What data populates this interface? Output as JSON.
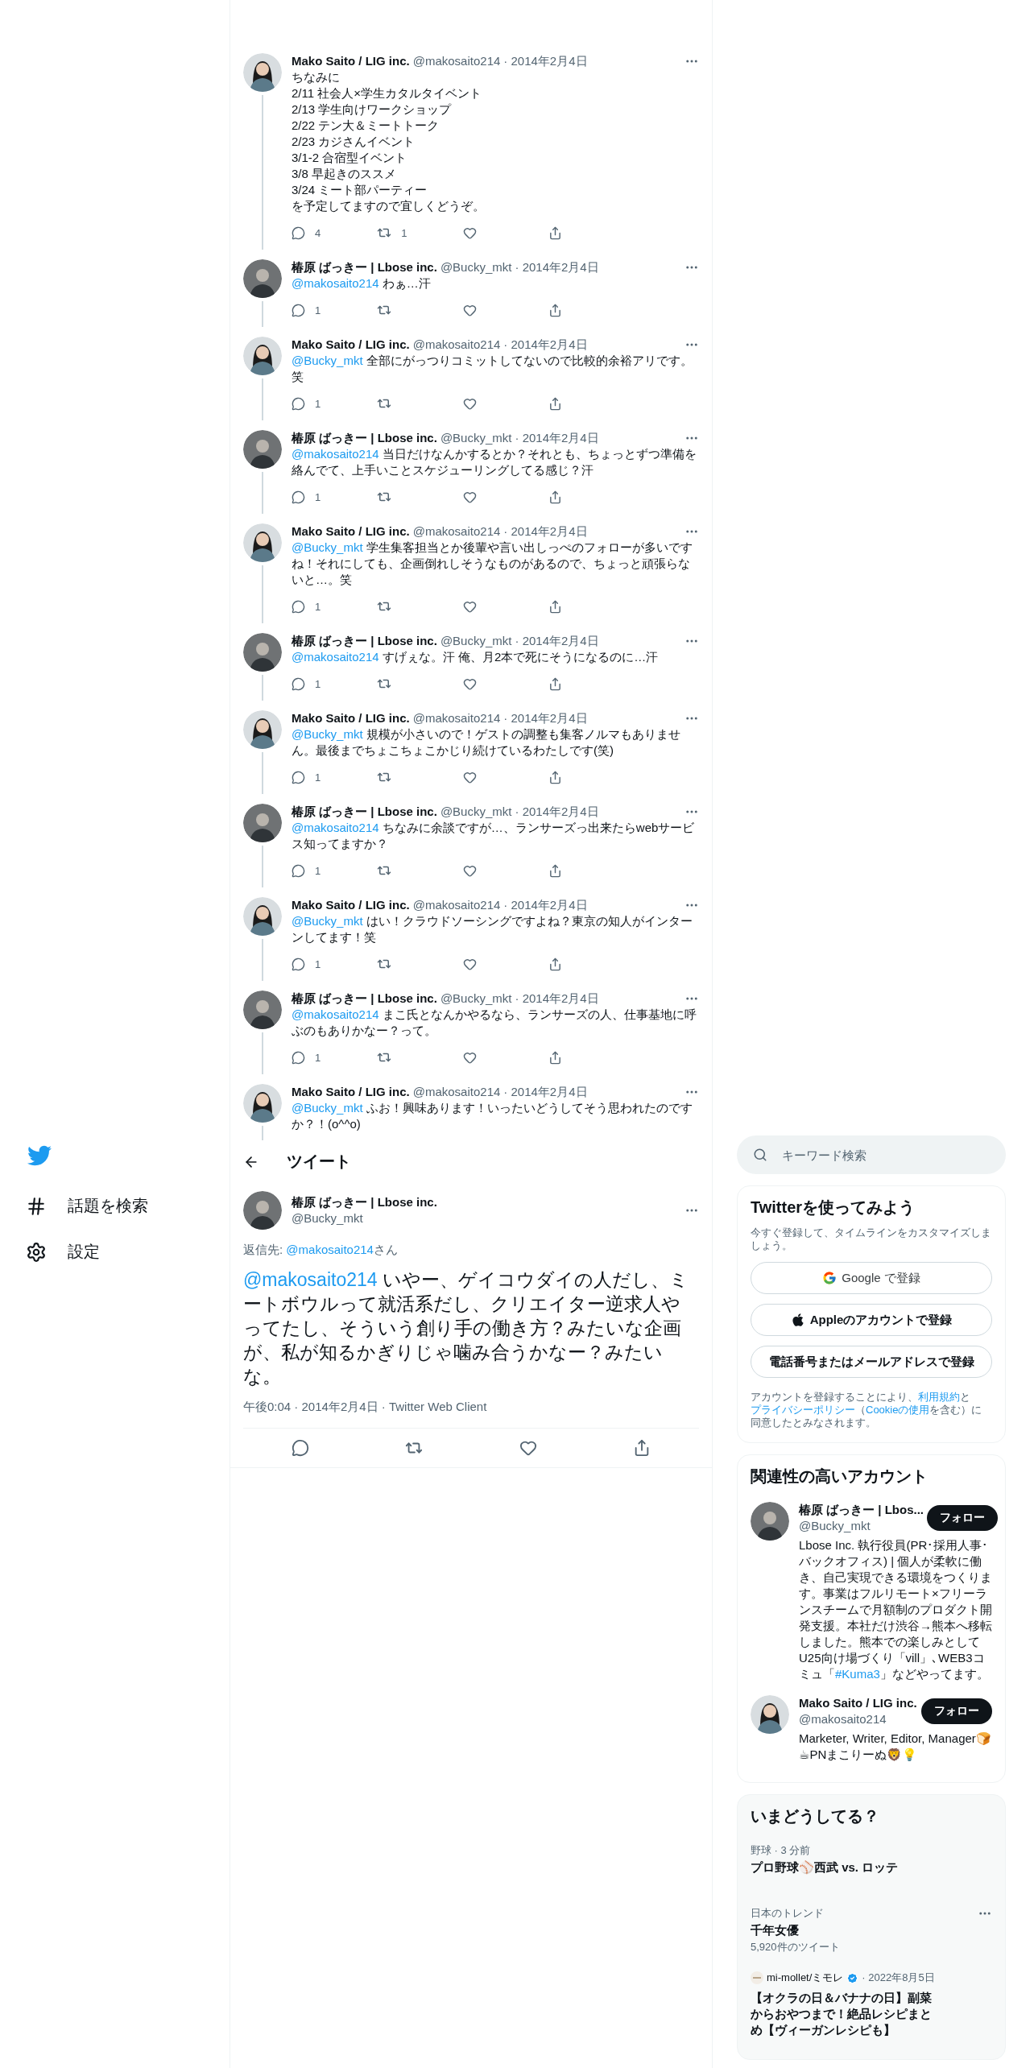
{
  "thread": [
    {
      "name": "Mako Saito / LIG inc.",
      "handle": "@makosaito214",
      "date": "· 2014年2月4日",
      "kind": "woman",
      "lines": [
        "ちなみに",
        "2/11 社会人×学生カタルタイベント",
        "2/13 学生向けワークショップ",
        "2/22 テン大＆ミートトーク",
        "2/23 カジさんイベント",
        "3/1-2 合宿型イベント",
        "3/8 早起きのススメ",
        "3/24 ミート部パーティー",
        "を予定してますので宜しくどうぞ。"
      ],
      "replies": "4",
      "retweets": "1"
    },
    {
      "name": "椿原 ばっきー | Lbose inc.",
      "handle": "@Bucky_mkt",
      "date": "· 2014年2月4日",
      "kind": "man",
      "mention": "@makosaito214",
      "text": " わぁ…汗",
      "replies": "1"
    },
    {
      "name": "Mako Saito / LIG inc.",
      "handle": "@makosaito214",
      "date": "· 2014年2月4日",
      "kind": "woman",
      "mention": "@Bucky_mkt",
      "text": " 全部にがっつりコミットしてないので比較的余裕アリです。笑",
      "replies": "1"
    },
    {
      "name": "椿原 ばっきー | Lbose inc.",
      "handle": "@Bucky_mkt",
      "date": "· 2014年2月4日",
      "kind": "man",
      "mention": "@makosaito214",
      "text": " 当日だけなんかするとか？それとも、ちょっとずつ準備を絡んでて、上手いことスケジューリングしてる感じ？汗",
      "replies": "1"
    },
    {
      "name": "Mako Saito / LIG inc.",
      "handle": "@makosaito214",
      "date": "· 2014年2月4日",
      "kind": "woman",
      "mention": "@Bucky_mkt",
      "text": " 学生集客担当とか後輩や言い出しっぺのフォローが多いですね！それにしても、企画倒れしそうなものがあるので、ちょっと頑張らないと…。笑",
      "replies": "1"
    },
    {
      "name": "椿原 ばっきー | Lbose inc.",
      "handle": "@Bucky_mkt",
      "date": "· 2014年2月4日",
      "kind": "man",
      "mention": "@makosaito214",
      "text": " すげぇな。汗 俺、月2本で死にそうになるのに…汗",
      "replies": "1"
    },
    {
      "name": "Mako Saito / LIG inc.",
      "handle": "@makosaito214",
      "date": "· 2014年2月4日",
      "kind": "woman",
      "mention": "@Bucky_mkt",
      "text": " 規模が小さいので！ゲストの調整も集客ノルマもありません。最後までちょこちょこかじり続けているわたしです(笑)",
      "replies": "1"
    },
    {
      "name": "椿原 ばっきー | Lbose inc.",
      "handle": "@Bucky_mkt",
      "date": "· 2014年2月4日",
      "kind": "man",
      "mention": "@makosaito214",
      "text": " ちなみに余談ですが…、ランサーズっ出来たらwebサービス知ってますか？",
      "replies": "1"
    },
    {
      "name": "Mako Saito / LIG inc.",
      "handle": "@makosaito214",
      "date": "· 2014年2月4日",
      "kind": "woman",
      "mention": "@Bucky_mkt",
      "text": " はい！クラウドソーシングですよね？東京の知人がインターンしてます！笑",
      "replies": "1"
    },
    {
      "name": "椿原 ばっきー | Lbose inc.",
      "handle": "@Bucky_mkt",
      "date": "· 2014年2月4日",
      "kind": "man",
      "mention": "@makosaito214",
      "text": " まこ氏となんかやるなら、ランサーズの人、仕事基地に呼ぶのもありかなー？って。",
      "replies": "1"
    },
    {
      "name": "Mako Saito / LIG inc.",
      "handle": "@makosaito214",
      "date": "· 2014年2月4日",
      "kind": "woman",
      "mention": "@Bucky_mkt",
      "text": " ふお！興味あります！いったいどうしてそう思われたのですか？！(o^^o)"
    }
  ],
  "header": {
    "title": "ツイート"
  },
  "main_tweet": {
    "name": "椿原 ばっきー | Lbose inc.",
    "handle": "@Bucky_mkt",
    "kind": "man",
    "reply_label": "返信先: ",
    "reply_to": "@makosaito214",
    "reply_suffix": "さん",
    "mention": "@makosaito214",
    "text": " いやー、ゲイコウダイの人だし、ミートボウルって就活系だし、クリエイター逆求人やってたし、そういう創り手の働き方？みたいな企画が、私が知るかぎりじゃ噛み合うかなー？みたいな。",
    "meta": "午後0:04 · 2014年2月4日 · Twitter Web Client"
  },
  "nav": {
    "items": [
      {
        "label": "話題を検索"
      },
      {
        "label": "設定"
      }
    ]
  },
  "search": {
    "placeholder": "キーワード検索"
  },
  "signup": {
    "title": "Twitterを使ってみよう",
    "subtitle": "今すぐ登録して、タイムラインをカスタマイズしましょう。",
    "buttons": [
      {
        "kind": "google",
        "label": "Google で登録"
      },
      {
        "kind": "apple",
        "label": "Appleのアカウントで登録"
      },
      {
        "kind": "plain",
        "label": "電話番号またはメールアドレスで登録"
      }
    ],
    "legal": [
      {
        "text": "アカウントを登録することにより、"
      },
      {
        "text": "利用規約",
        "link": true
      },
      {
        "text": "と"
      },
      {
        "text": "プライバシーポリシー",
        "link": true
      },
      {
        "text": "（"
      },
      {
        "text": "Cookieの使用",
        "link": true
      },
      {
        "text": "を含む）に同意したとみなされます。"
      }
    ]
  },
  "related": {
    "title": "関連性の高いアカウント",
    "accounts": [
      {
        "name": "椿原 ばっきー | Lbos...",
        "handle": "@Bucky_mkt",
        "kind": "man",
        "button": "フォロー",
        "bio": [
          {
            "text": "Lbose Inc. 執行役員(PR･採用人事･バックオフィス) | 個人が柔軟に働き、自己実現できる環境をつくります。事業はフルリモート×フリーランスチームで月額制のプロダクト開発支援。本社だけ渋谷→熊本へ移転しました。熊本での楽しみとしてU25向け場づくり「vill」､WEB3コミュ「"
          },
          {
            "text": "#Kuma3",
            "link": true
          },
          {
            "text": "」などやってます。"
          }
        ]
      },
      {
        "name": "Mako Saito / LIG inc.",
        "handle": "@makosaito214",
        "kind": "woman",
        "button": "フォロー",
        "bio": [
          {
            "text": "Marketer, Writer, Editor, Manager🍞☕PNまこりーぬ🦁💡"
          }
        ]
      }
    ]
  },
  "trends": {
    "title": "いまどうしてる？",
    "items": [
      {
        "kind": "event",
        "meta": "野球 · 3 分前",
        "title": "プロ野球⚾西武 vs. ロッテ"
      },
      {
        "kind": "trend",
        "meta": "日本のトレンド",
        "title": "千年女優",
        "count": "5,920件のツイート"
      },
      {
        "kind": "news",
        "source": "mi-mollet/ミモレ",
        "verified": true,
        "date": "· 2022年8月5日",
        "title": "【オクラの日＆バナナの日】副菜からおやつまで！絶品レシピまとめ【ヴィーガンレシピも】"
      }
    ]
  }
}
